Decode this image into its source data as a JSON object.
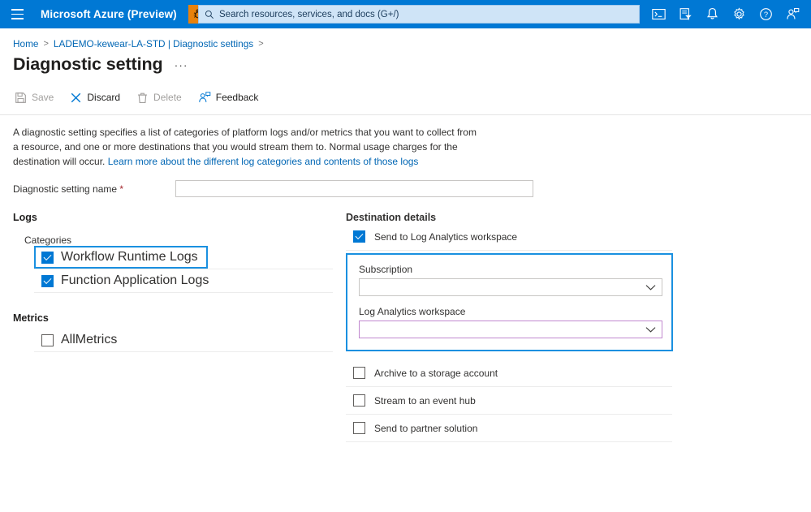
{
  "topbar": {
    "menu_icon": "hamburger-icon",
    "brand": "Microsoft Azure (Preview)",
    "bug_icon": "bug-icon",
    "search": {
      "icon": "search-icon",
      "placeholder": "Search resources, services, and docs (G+/)",
      "value": ""
    },
    "icons": [
      {
        "name": "cloud-shell-icon",
        "title": "Cloud Shell"
      },
      {
        "name": "directory-filter-icon",
        "title": "Directories + subscriptions"
      },
      {
        "name": "notifications-bell-icon",
        "title": "Notifications"
      },
      {
        "name": "settings-gear-icon",
        "title": "Settings"
      },
      {
        "name": "help-question-icon",
        "title": "Help"
      },
      {
        "name": "feedback-person-icon",
        "title": "Feedback"
      }
    ],
    "accent_color": "#0078d4",
    "bug_color": "#e8820c"
  },
  "breadcrumb": {
    "items": [
      {
        "label": "Home"
      },
      {
        "label": "LADEMO-kewear-LA-STD | Diagnostic settings"
      }
    ],
    "separator": ">"
  },
  "page": {
    "title": "Diagnostic setting",
    "ellipsis": "···"
  },
  "toolbar": {
    "items": [
      {
        "label": "Save",
        "icon": "save-icon",
        "enabled": false
      },
      {
        "label": "Discard",
        "icon": "discard-x-icon",
        "enabled": true
      },
      {
        "label": "Delete",
        "icon": "delete-trash-icon",
        "enabled": false
      },
      {
        "label": "Feedback",
        "icon": "feedback-person-icon",
        "enabled": true
      }
    ]
  },
  "description": {
    "text": "A diagnostic setting specifies a list of categories of platform logs and/or metrics that you want to collect from a resource, and one or more destinations that you would stream them to. Normal usage charges for the destination will occur. ",
    "link_text": "Learn more about the different log categories and contents of those logs",
    "link_color": "#0066b4"
  },
  "name_field": {
    "label": "Diagnostic setting name",
    "required_marker": "*",
    "value": "",
    "placeholder": ""
  },
  "logs": {
    "heading": "Logs",
    "subheading": "Categories",
    "categories": [
      {
        "label": "Workflow Runtime Logs",
        "checked": true,
        "focused": true
      },
      {
        "label": "Function Application Logs",
        "checked": true,
        "focused": false
      }
    ]
  },
  "metrics": {
    "heading": "Metrics",
    "items": [
      {
        "label": "AllMetrics",
        "checked": false
      }
    ]
  },
  "destination": {
    "heading": "Destination details",
    "options": [
      {
        "label": "Send to Log Analytics workspace",
        "checked": true
      },
      {
        "label": "Archive to a storage account",
        "checked": false
      },
      {
        "label": "Stream to an event hub",
        "checked": false
      },
      {
        "label": "Send to partner solution",
        "checked": false
      }
    ],
    "log_analytics_group": {
      "focus_color": "#1a90e0",
      "fields": [
        {
          "label": "Subscription",
          "value": "",
          "border_color": "#c8c6c4"
        },
        {
          "label": "Log Analytics workspace",
          "value": "",
          "border_color": "#c188cf"
        }
      ],
      "chevron": "∨"
    }
  }
}
